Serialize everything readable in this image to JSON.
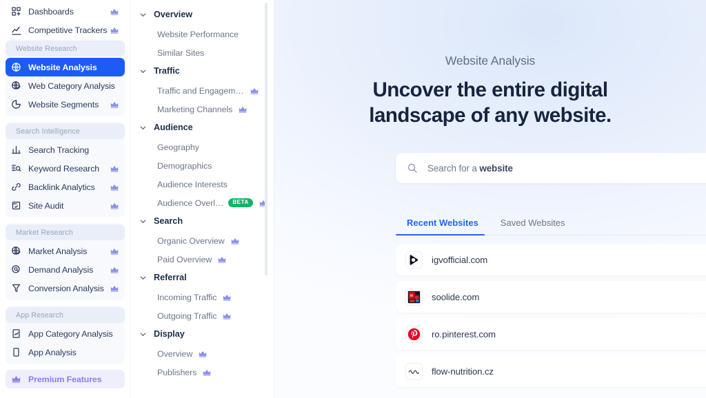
{
  "sidebar": {
    "top_items": [
      {
        "label": "Dashboards",
        "icon": "dashboards-icon",
        "premium": true
      },
      {
        "label": "Competitive Trackers",
        "icon": "trend-chart-icon",
        "premium": true
      }
    ],
    "groups": [
      {
        "title": "Website Research",
        "items": [
          {
            "label": "Website Analysis",
            "icon": "globe-icon",
            "premium": false,
            "active": true
          },
          {
            "label": "Web Category Analysis",
            "icon": "globe-check-icon",
            "premium": false,
            "active": false
          },
          {
            "label": "Website Segments",
            "icon": "pie-segment-icon",
            "premium": true,
            "active": false
          }
        ]
      },
      {
        "title": "Search Intelligence",
        "items": [
          {
            "label": "Search Tracking",
            "icon": "bar-chart-icon",
            "premium": false,
            "active": false
          },
          {
            "label": "Keyword Research",
            "icon": "keyword-search-icon",
            "premium": true,
            "active": false
          },
          {
            "label": "Backlink Analytics",
            "icon": "link-icon",
            "premium": true,
            "active": false
          },
          {
            "label": "Site Audit",
            "icon": "clipboard-check-icon",
            "premium": true,
            "active": false
          }
        ]
      },
      {
        "title": "Market Research",
        "items": [
          {
            "label": "Market Analysis",
            "icon": "globe-check-icon",
            "premium": true,
            "active": false
          },
          {
            "label": "Demand Analysis",
            "icon": "magnifier-circle-icon",
            "premium": true,
            "active": false
          },
          {
            "label": "Conversion Analysis",
            "icon": "funnel-icon",
            "premium": true,
            "active": false
          }
        ]
      },
      {
        "title": "App Research",
        "items": [
          {
            "label": "App Category Analysis",
            "icon": "app-chart-icon",
            "premium": false,
            "active": false
          },
          {
            "label": "App Analysis",
            "icon": "phone-icon",
            "premium": false,
            "active": false
          }
        ]
      }
    ],
    "premium_item": {
      "label": "Premium Features",
      "icon": "crown-icon"
    }
  },
  "subnav": {
    "sections": [
      {
        "title": "Overview",
        "items": [
          {
            "label": "Website Performance",
            "premium": false,
            "beta": false
          },
          {
            "label": "Similar Sites",
            "premium": false,
            "beta": false
          }
        ]
      },
      {
        "title": "Traffic",
        "items": [
          {
            "label": "Traffic and Engagem…",
            "premium": true,
            "beta": false
          },
          {
            "label": "Marketing Channels",
            "premium": true,
            "beta": false
          }
        ]
      },
      {
        "title": "Audience",
        "items": [
          {
            "label": "Geography",
            "premium": false,
            "beta": false
          },
          {
            "label": "Demographics",
            "premium": false,
            "beta": false
          },
          {
            "label": "Audience Interests",
            "premium": false,
            "beta": false
          },
          {
            "label": "Audience Overl…",
            "premium": true,
            "beta": true,
            "beta_label": "BETA"
          }
        ]
      },
      {
        "title": "Search",
        "items": [
          {
            "label": "Organic Overview",
            "premium": true,
            "beta": false
          },
          {
            "label": "Paid Overview",
            "premium": true,
            "beta": false
          }
        ]
      },
      {
        "title": "Referral",
        "items": [
          {
            "label": "Incoming Traffic",
            "premium": true,
            "beta": false
          },
          {
            "label": "Outgoing Traffic",
            "premium": true,
            "beta": false
          }
        ]
      },
      {
        "title": "Display",
        "items": [
          {
            "label": "Overview",
            "premium": true,
            "beta": false
          },
          {
            "label": "Publishers",
            "premium": true,
            "beta": false
          }
        ]
      }
    ]
  },
  "main": {
    "eyebrow": "Website Analysis",
    "title_line1": "Uncover the entire digital",
    "title_line2": "landscape of any website.",
    "search": {
      "placeholder_prefix": "Search for a ",
      "placeholder_strong": "website",
      "icon": "search-icon"
    },
    "tabs": [
      {
        "label": "Recent Websites",
        "active": true
      },
      {
        "label": "Saved Websites",
        "active": false
      }
    ],
    "websites": [
      {
        "domain": "igvofficial.com",
        "favicon": "play-triangle-icon",
        "favicon_color": "#14101c"
      },
      {
        "domain": "soolide.com",
        "favicon": "red-square-icon",
        "favicon_color": "#c8102e"
      },
      {
        "domain": "ro.pinterest.com",
        "favicon": "pinterest-icon",
        "favicon_color": "#e60023"
      },
      {
        "domain": "flow-nutrition.cz",
        "favicon": "wave-icon",
        "favicon_color": "#4a5568"
      }
    ]
  },
  "colors": {
    "accent_blue": "#1a5cf5",
    "tab_blue": "#2563f0",
    "premium_purple": "#8b8ef0",
    "beta_green": "#17b26a",
    "text_dark": "#16243f"
  }
}
